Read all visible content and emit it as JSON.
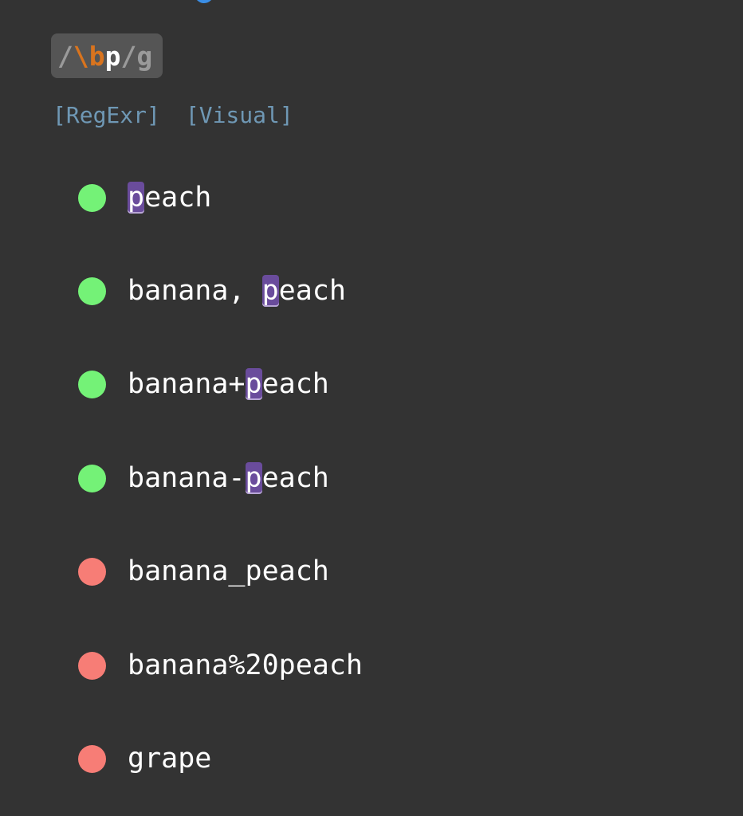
{
  "regex": {
    "open_delim": "/",
    "escape": "\\b",
    "literal": "p",
    "close_delim": "/",
    "flags": "g"
  },
  "links": {
    "regexr": "[RegExr]",
    "visual": "[Visual]"
  },
  "tests": [
    {
      "before": "",
      "match": "p",
      "after": "each",
      "matched": true
    },
    {
      "before": "banana, ",
      "match": "p",
      "after": "each",
      "matched": true
    },
    {
      "before": "banana+",
      "match": "p",
      "after": "each",
      "matched": true
    },
    {
      "before": "banana-",
      "match": "p",
      "after": "each",
      "matched": true
    },
    {
      "before": "banana_peach",
      "match": "",
      "after": "",
      "matched": false
    },
    {
      "before": "banana%20peach",
      "match": "",
      "after": "",
      "matched": false
    },
    {
      "before": "grape",
      "match": "",
      "after": "",
      "matched": false
    }
  ],
  "colors": {
    "background": "#333333",
    "match": "#74f277",
    "no_match": "#f77d76",
    "highlight": "#6a4c9c",
    "link": "#6f98b5",
    "escape": "#d9741e"
  }
}
